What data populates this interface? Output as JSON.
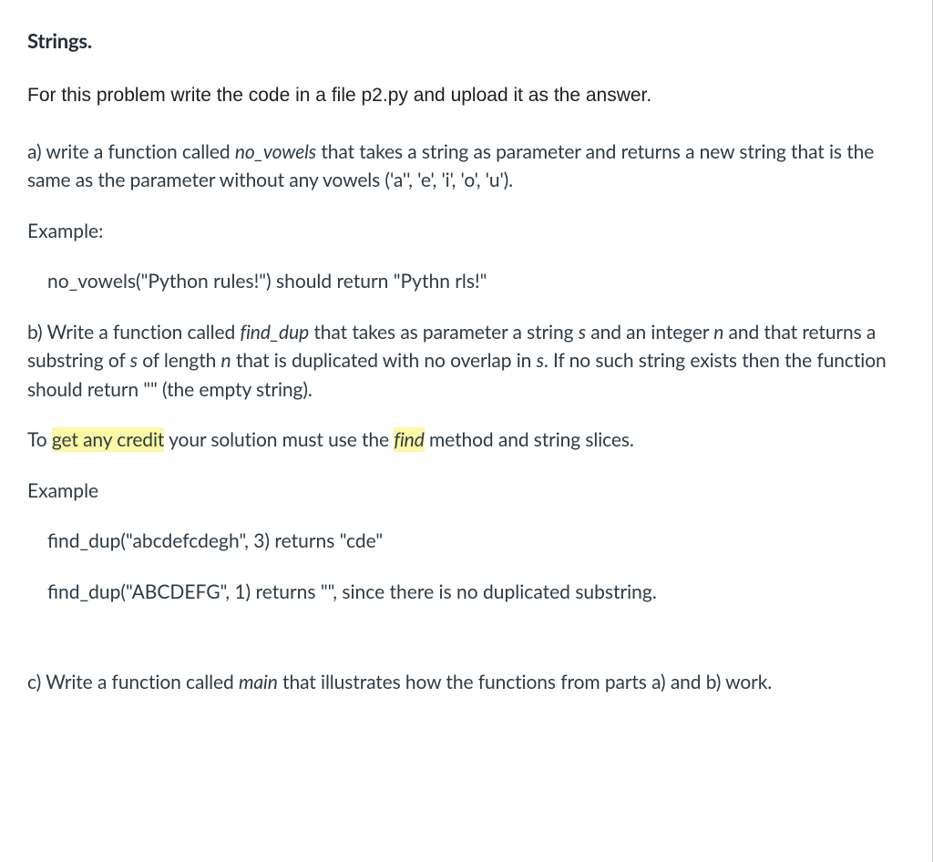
{
  "heading": "Strings.",
  "instruction": "For this problem write the code in a file p2.py and upload it as the answer.",
  "partA": {
    "prefix": "a) write a function called ",
    "funcName": "no_vowels",
    "rest": " that takes a string as parameter and returns a new string that is the same as the parameter without any vowels ('a'', 'e', 'i', 'o', 'u')."
  },
  "exampleLabelA": "Example:",
  "exampleA": "no_vowels(\"Python rules!\") should return \"Pythn rls!\"",
  "partB": {
    "prefix": "b) Write a function called ",
    "funcName": "find_dup",
    "mid1": " that takes as parameter a string ",
    "var_s": "s",
    "mid2": " and an integer ",
    "var_n": "n",
    "mid3": " and that returns a substring of ",
    "var_s2": "s",
    "mid4": " of length ",
    "var_n2": "n",
    "mid5": " that is duplicated with no overlap in ",
    "var_s3": "s",
    "suffix": ". If no such string exists then the function should return \"\" (the empty string)."
  },
  "credit": {
    "prefix": "To ",
    "highlight1": "get any credit",
    "mid": " your solution must use the ",
    "highlight2": "find",
    "suffix": " method and string slices."
  },
  "exampleLabelB": "Example",
  "exampleB1": "find_dup(\"abcdefcdegh\", 3) returns \"cde\"",
  "exampleB2": "find_dup(\"ABCDEFG\", 1) returns \"\", since there is no duplicated substring.",
  "partC": {
    "prefix": "c) Write a function called ",
    "funcName": "main",
    "suffix": " that illustrates how the functions from parts a) and b) work."
  }
}
